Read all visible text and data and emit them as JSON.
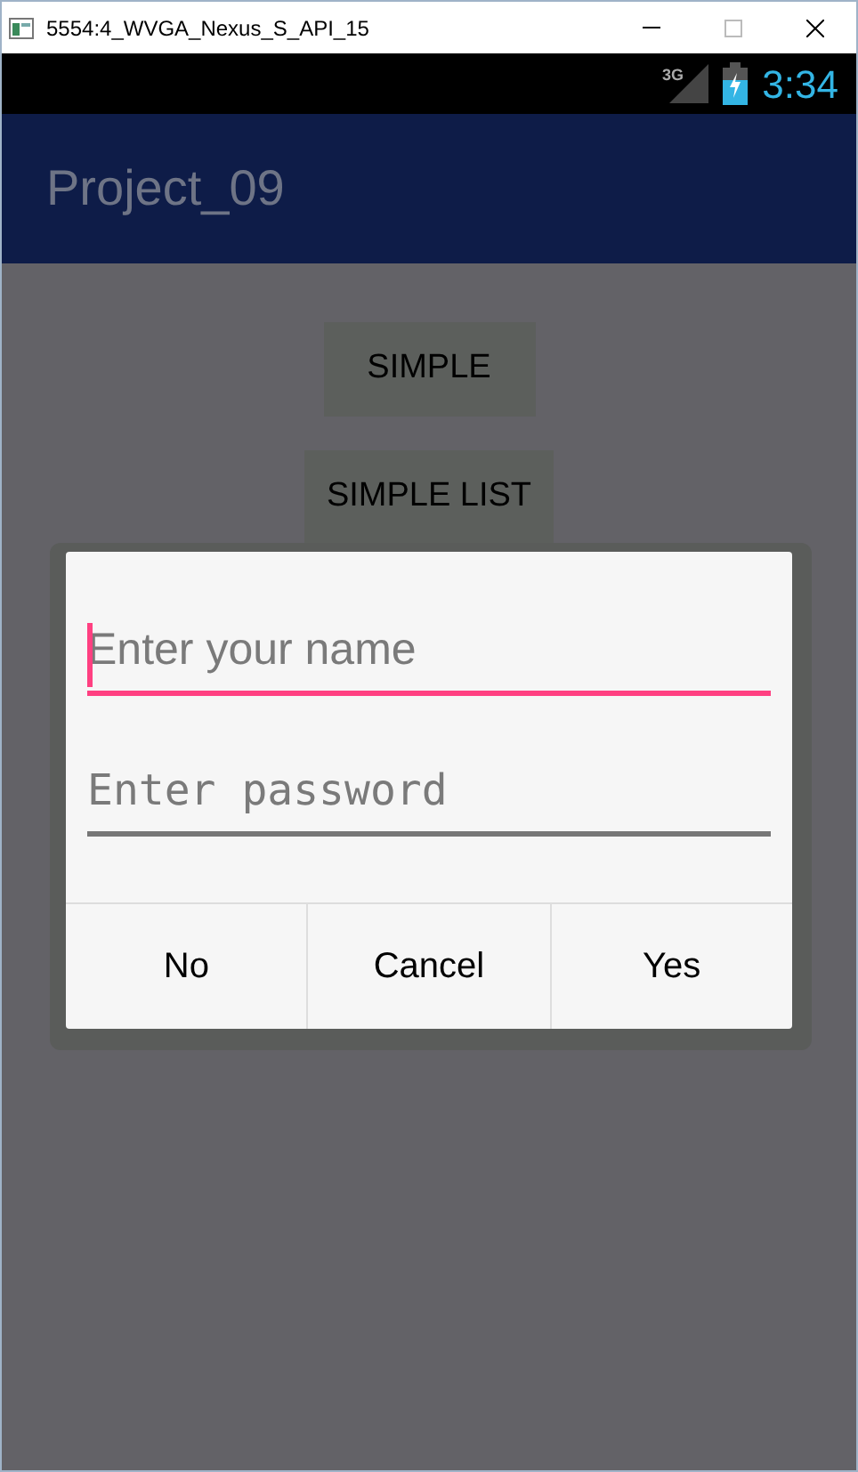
{
  "window": {
    "title": "5554:4_WVGA_Nexus_S_API_15"
  },
  "status_bar": {
    "network": "3G",
    "time": "3:34"
  },
  "app_bar": {
    "title": "Project_09"
  },
  "buttons": [
    "SIMPLE",
    "SIMPLE LIST"
  ],
  "dialog": {
    "fields": [
      {
        "placeholder": "Enter your name",
        "kind": "text",
        "focused": true
      },
      {
        "placeholder": "Enter password",
        "kind": "password",
        "focused": false
      }
    ],
    "actions": [
      "No",
      "Cancel",
      "Yes"
    ]
  }
}
